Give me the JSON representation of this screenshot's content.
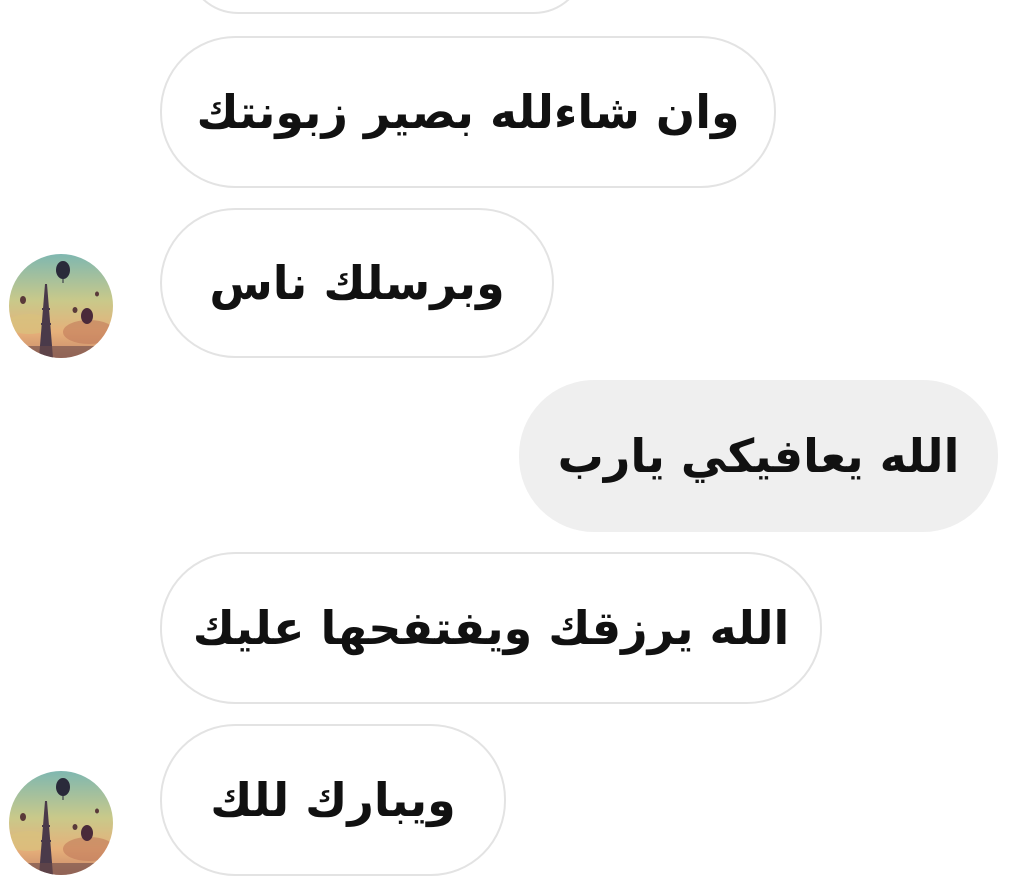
{
  "conversation": {
    "messages": [
      {
        "sender": "them",
        "text": ""
      },
      {
        "sender": "them",
        "text": "وان شاءلله بصير زبونتك"
      },
      {
        "sender": "them",
        "text": "وبرسلك ناس"
      },
      {
        "sender": "me",
        "text": "الله يعافيكي يارب"
      },
      {
        "sender": "them",
        "text": "الله يرزقك ويفتفحها عليك"
      },
      {
        "sender": "them",
        "text": "ويبارك للك"
      }
    ],
    "contact_avatar": {
      "icon": "eiffel-tower-balloons-avatar"
    }
  },
  "colors": {
    "background": "#ffffff",
    "incoming_bubble": "#ffffff",
    "incoming_border": "#e3e3e3",
    "outgoing_bubble": "#efefef",
    "text": "#111111"
  }
}
